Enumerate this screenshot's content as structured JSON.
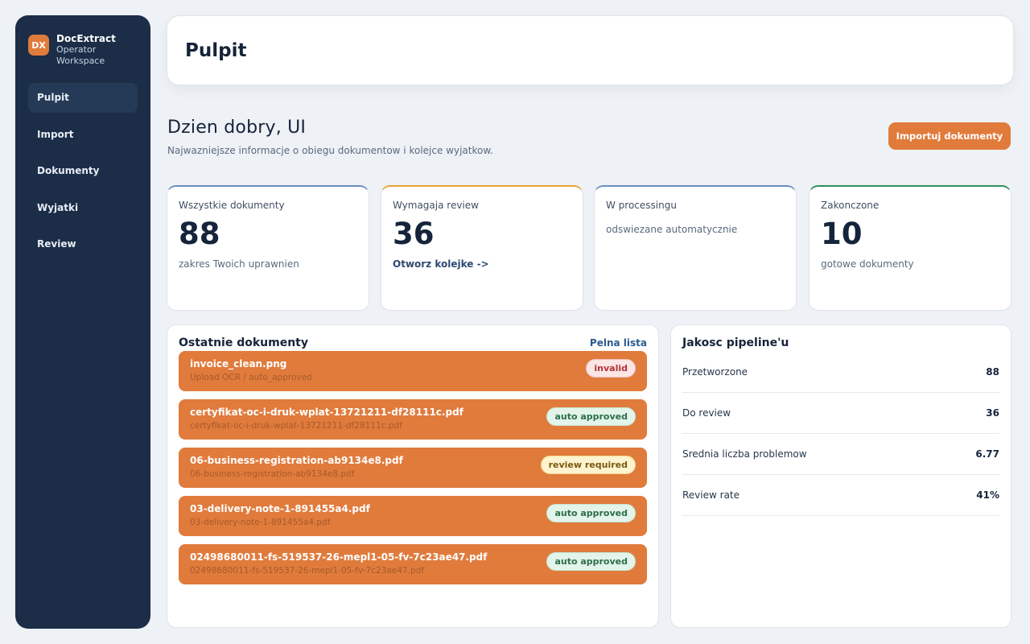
{
  "brand": {
    "logo_text": "DX",
    "name": "DocExtract",
    "subtitle_line1": "Operator",
    "subtitle_line2": "Workspace"
  },
  "nav": {
    "items": [
      {
        "label": "Pulpit",
        "active": true
      },
      {
        "label": "Import",
        "active": false
      },
      {
        "label": "Dokumenty",
        "active": false
      },
      {
        "label": "Wyjatki",
        "active": false
      },
      {
        "label": "Review",
        "active": false
      }
    ]
  },
  "header": {
    "title": "Pulpit"
  },
  "greeting": {
    "title": "Dzien dobry, UI",
    "subtitle": "Najwazniejsze informacje o obiegu dokumentow i kolejce wyjatkow."
  },
  "actions": {
    "import_label": "Importuj dokumenty"
  },
  "stats": [
    {
      "title": "Wszystkie dokumenty",
      "value": "88",
      "sub": "zakres Twoich uprawnien",
      "accent": "#6a8fc0"
    },
    {
      "title": "Wymagaja review",
      "value": "36",
      "link": "Otworz kolejke ->",
      "accent": "#e8a23a"
    },
    {
      "title": "W processingu",
      "sub": "odswiezane automatycznie",
      "accent": "#6a8fc0"
    },
    {
      "title": "Zakonczone",
      "value": "10",
      "sub": "gotowe dokumenty",
      "accent": "#2f8f5e"
    }
  ],
  "recent": {
    "title": "Ostatnie dokumenty",
    "link": "Pelna lista",
    "items": [
      {
        "name": "invoice_clean.png",
        "sub": "Upload OCR / auto_approved",
        "badge": "invalid",
        "badge_type": "invalid"
      },
      {
        "name": "certyfikat-oc-i-druk-wplat-13721211-df28111c.pdf",
        "sub": "certyfikat-oc-i-druk-wplat-13721211-df28111c.pdf",
        "badge": "auto approved",
        "badge_type": "approved"
      },
      {
        "name": "06-business-registration-ab9134e8.pdf",
        "sub": "06-business-registration-ab9134e8.pdf",
        "badge": "review required",
        "badge_type": "review"
      },
      {
        "name": "03-delivery-note-1-891455a4.pdf",
        "sub": "03-delivery-note-1-891455a4.pdf",
        "badge": "auto approved",
        "badge_type": "approved"
      },
      {
        "name": "02498680011-fs-519537-26-mepl1-05-fv-7c23ae47.pdf",
        "sub": "02498680011-fs-519537-26-mepl1-05-fv-7c23ae47.pdf",
        "badge": "auto approved",
        "badge_type": "approved"
      }
    ]
  },
  "pipeline": {
    "title": "Jakosc pipeline'u",
    "metrics": [
      {
        "label": "Przetworzone",
        "value": "88"
      },
      {
        "label": "Do review",
        "value": "36"
      },
      {
        "label": "Srednia liczba problemow",
        "value": "6.77"
      },
      {
        "label": "Review rate",
        "value": "41%"
      }
    ]
  }
}
